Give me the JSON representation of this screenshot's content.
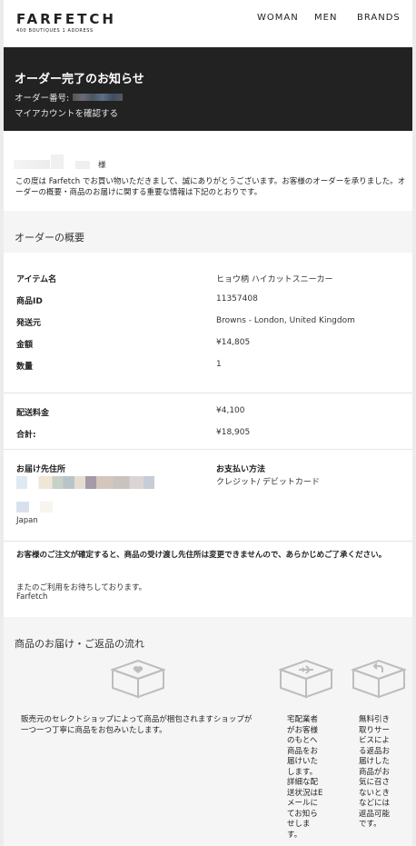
{
  "header": {
    "logo": "FARFETCH",
    "logo_sub": "400 BOUTIQUES 1 ADDRESS",
    "nav": [
      "WOMAN",
      "MEN",
      "BRANDS"
    ]
  },
  "hero": {
    "title": "オーダー完了のお知らせ",
    "order_label": "オーダー番号:",
    "account_link": "マイアカウントを確認する"
  },
  "greeting": {
    "honorific": "様",
    "message": "この度は Farfetch でお買い物いただきまして、誠にありがとうございます。お客様のオーダーを承りました。オーダーの概要・商品のお届けに関する重要な情報は下記のとおりです。"
  },
  "summary": {
    "title": "オーダーの概要",
    "rows": [
      {
        "label": "アイテム名",
        "value": "ヒョウ柄 ハイカットスニーカー"
      },
      {
        "label": "商品ID",
        "value": "11357408"
      },
      {
        "label": "発送元",
        "value": "Browns - London, United Kingdom"
      },
      {
        "label": "金額",
        "value": "¥14,805"
      },
      {
        "label": "数量",
        "value": "1"
      }
    ],
    "shipping_label": "配送料金",
    "shipping_value": "¥4,100",
    "total_label": "合計:",
    "total_value": "¥18,905",
    "address_label": "お届け先住所",
    "country": "Japan",
    "payment_label": "お支払い方法",
    "payment_value": "クレジット/ デビットカード",
    "notice": "お客様のご注文が確定すると、商品の受け渡し先住所は変更できませんので、あらかじめご了承ください。",
    "closing": "またのご利用をお待ちしております。",
    "signature": "Farfetch"
  },
  "flow": {
    "title": "商品のお届け・ご返品の流れ",
    "steps": [
      {
        "icon": "heart-box-icon",
        "text": "販売元のセレクトショップによって商品が梱包されますショップが一つ一つ丁寧に商品をお包みいたします。"
      },
      {
        "icon": "plane-box-icon",
        "text": "宅配業者がお客様のもとへ商品をお届けいたします。詳細な配送状況はEメールにてお知らせします。"
      },
      {
        "icon": "return-box-icon",
        "text": "無料引き取りサービスによる返品お届けした商品がお気に召さないときなどには返品可能です。"
      }
    ]
  }
}
